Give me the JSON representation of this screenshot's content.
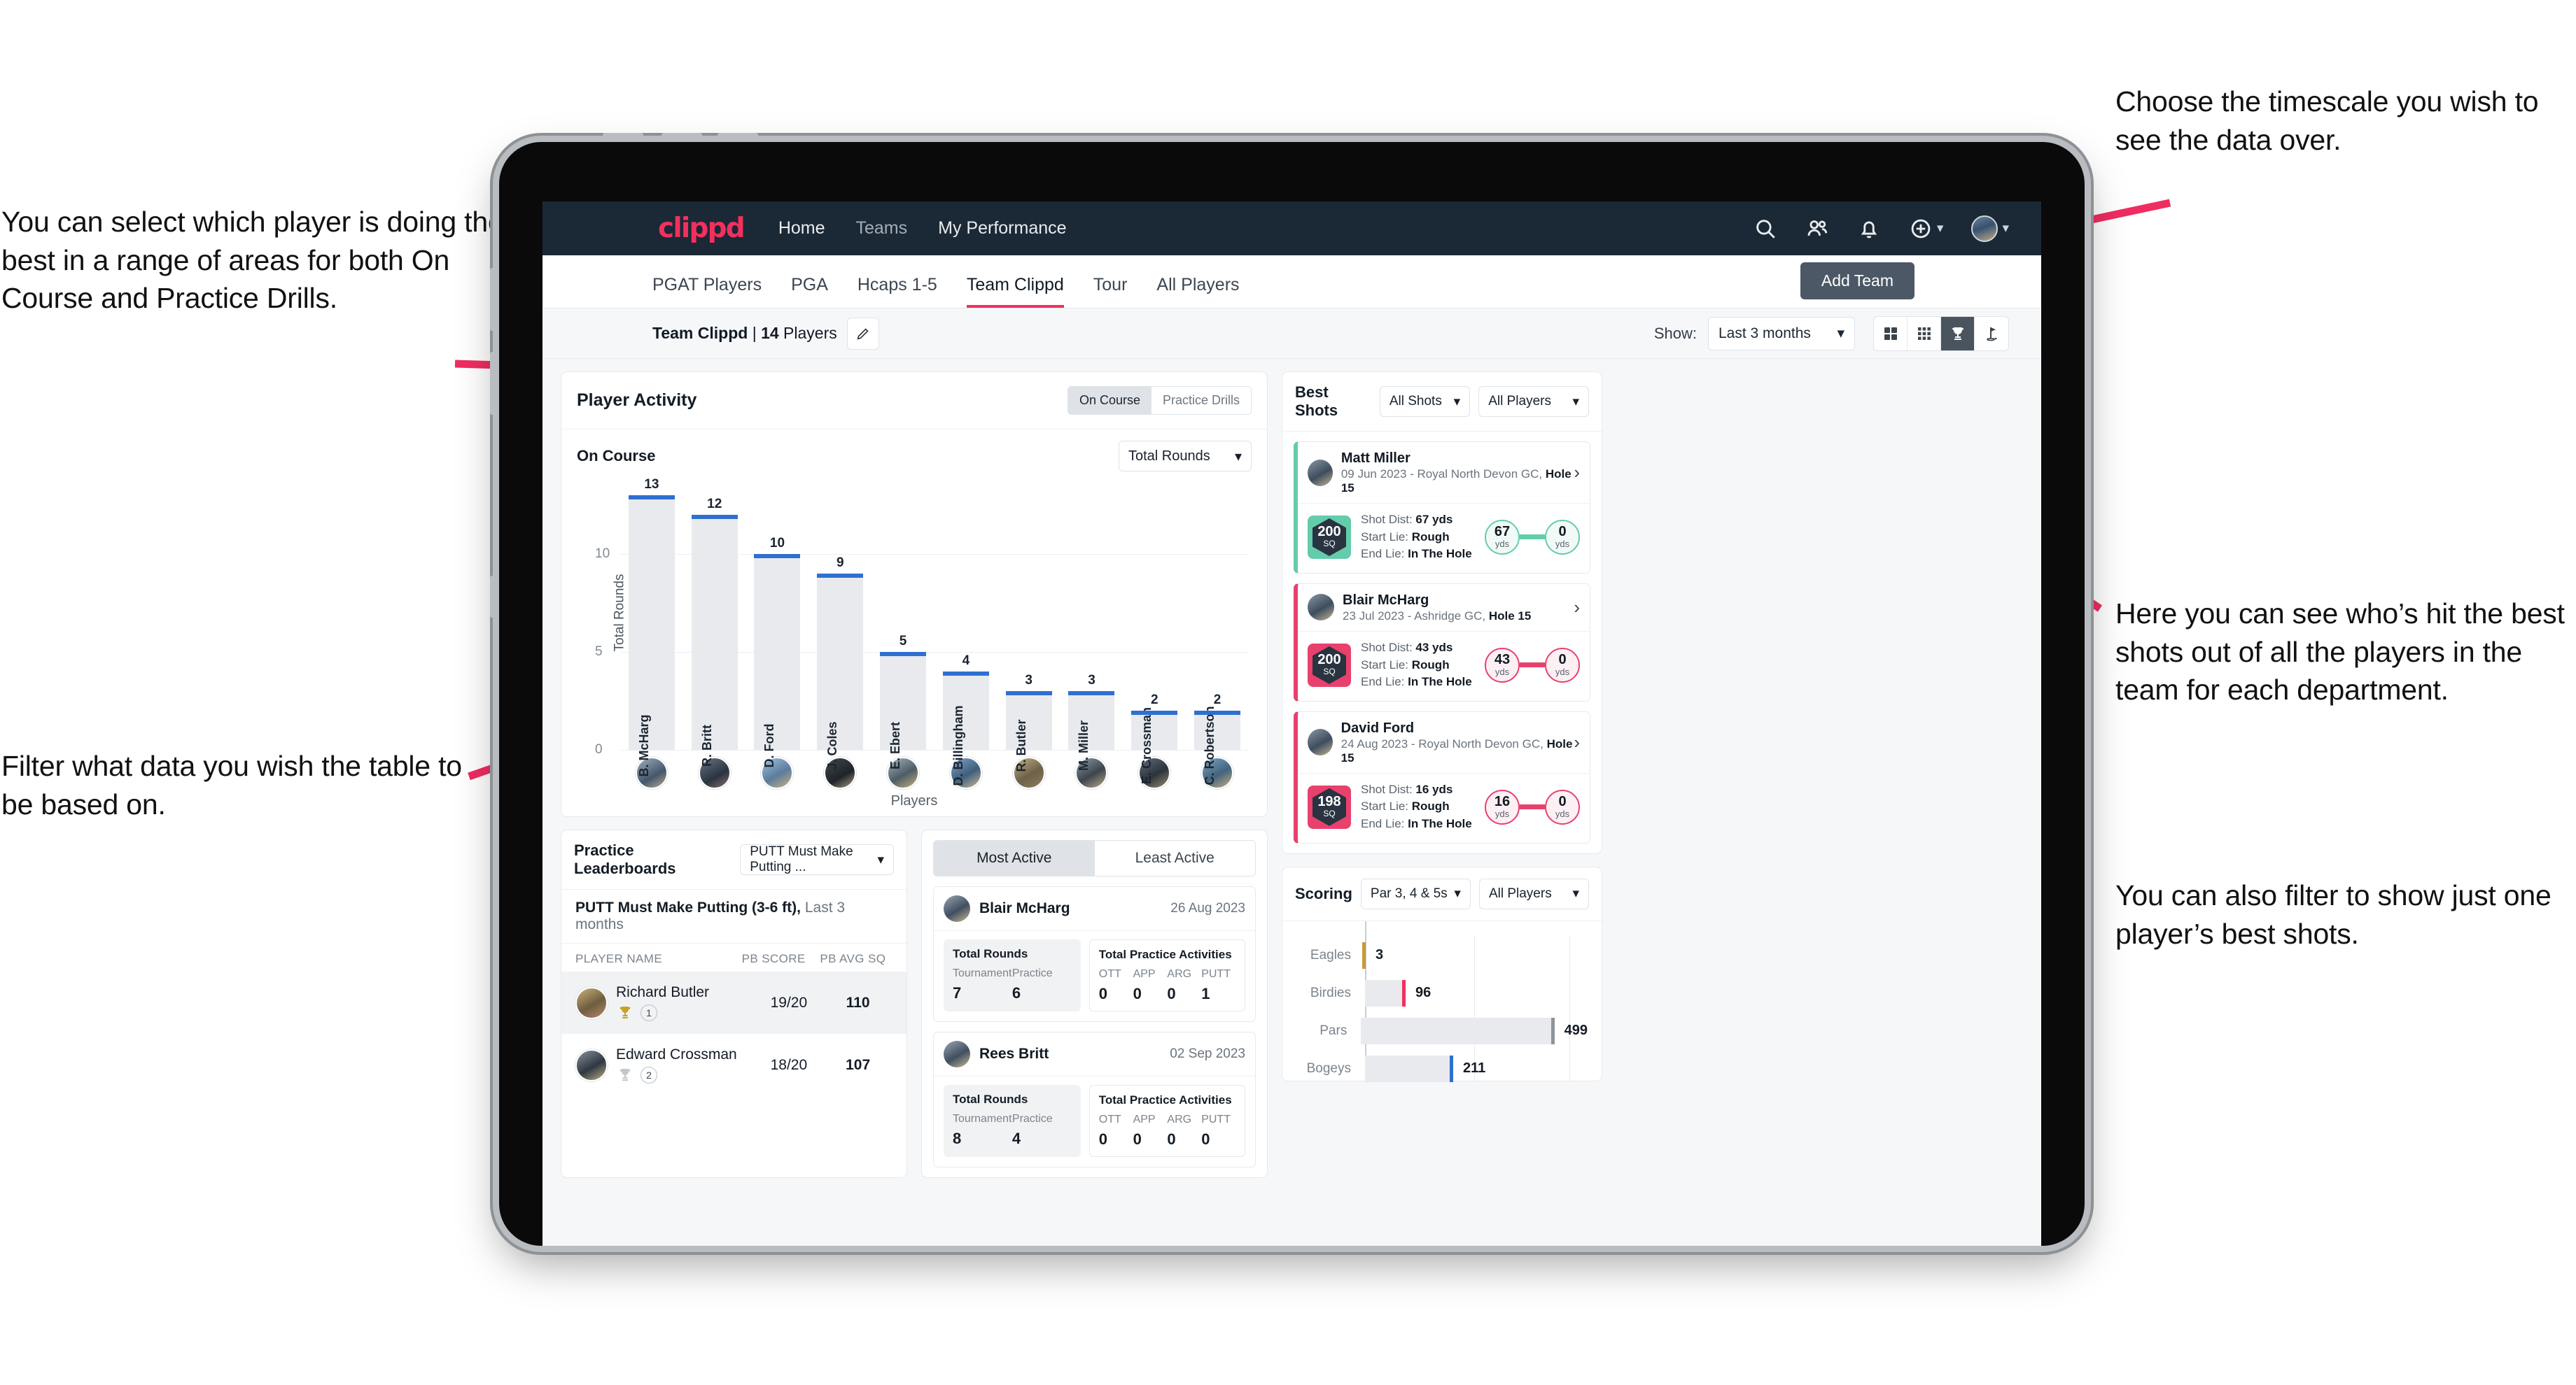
{
  "annotations": {
    "left_top": "You can select which player is doing the best in a range of areas for both On Course and Practice Drills.",
    "left_bottom": "Filter what data you wish the table to be based on.",
    "right_top": "Choose the timescale you wish to see the data over.",
    "right_middle": "Here you can see who’s hit the best shots out of all the players in the team for each department.",
    "right_bottom": "You can also filter to show just one player’s best shots."
  },
  "brand": {
    "logo": "clippd",
    "accent": "#f2305e",
    "navbg": "#1b2836"
  },
  "topnav": {
    "links": [
      {
        "label": "Home"
      },
      {
        "label": "Teams"
      },
      {
        "label": "My Performance"
      }
    ],
    "icons": [
      "search-icon",
      "people-icon",
      "bell-icon",
      "plus-circle-icon",
      "avatar"
    ]
  },
  "tabbar": {
    "tabs": [
      {
        "label": "PGAT Players",
        "active": false
      },
      {
        "label": "PGA",
        "active": false
      },
      {
        "label": "Hcaps 1-5",
        "active": false
      },
      {
        "label": "Team Clippd",
        "active": true
      },
      {
        "label": "Tour",
        "active": false
      },
      {
        "label": "All Players",
        "active": false
      }
    ],
    "add_team_label": "Add Team"
  },
  "subbar": {
    "team_name": "Team Clippd",
    "separator": " | ",
    "player_count": "14",
    "players_word": " Players",
    "show_label": "Show:",
    "timescale_value": "Last 3 months",
    "view_icons": [
      "grid-large-icon",
      "grid-small-icon",
      "trophy-icon",
      "flag-icon"
    ],
    "active_view": "trophy-icon"
  },
  "player_activity": {
    "title": "Player Activity",
    "segmented": [
      {
        "label": "On Course",
        "active": true
      },
      {
        "label": "Practice Drills",
        "active": false
      }
    ],
    "section_label": "On Course",
    "metric_value": "Total Rounds"
  },
  "chart_data": {
    "type": "bar",
    "title": "Player Activity – On Course",
    "xlabel": "Players",
    "ylabel": "Total Rounds",
    "ylim": [
      0,
      14
    ],
    "yticks": [
      "0",
      "5",
      "10"
    ],
    "grid": true,
    "categories": [
      "B. McHarg",
      "R. Britt",
      "D. Ford",
      "J. Coles",
      "E. Ebert",
      "D. Billingham",
      "R. Butler",
      "M. Miller",
      "E. Crossman",
      "C. Robertson"
    ],
    "values": [
      13,
      12,
      10,
      9,
      5,
      4,
      3,
      3,
      2,
      2
    ]
  },
  "best_shots": {
    "title": "Best Shots",
    "filter_shots": "All Shots",
    "filter_players": "All Players",
    "cards": [
      {
        "name": "Matt Miller",
        "meta_date": "09 Jun 2023 - Royal North Devon GC, ",
        "meta_hole": "Hole 15",
        "badge_value": "200",
        "badge_unit": "SQ",
        "shot_dist_label": "Shot Dist: ",
        "shot_dist_value": "67 yds",
        "start_lie_label": "Start Lie: ",
        "start_lie_value": "Rough",
        "end_lie_label": "End Lie: ",
        "end_lie_value": "In The Hole",
        "from_value": "67",
        "from_unit": "yds",
        "to_value": "0",
        "to_unit": "yds",
        "color": "teal"
      },
      {
        "name": "Blair McHarg",
        "meta_date": "23 Jul 2023 - Ashridge GC, ",
        "meta_hole": "Hole 15",
        "badge_value": "200",
        "badge_unit": "SQ",
        "shot_dist_label": "Shot Dist: ",
        "shot_dist_value": "43 yds",
        "start_lie_label": "Start Lie: ",
        "start_lie_value": "Rough",
        "end_lie_label": "End Lie: ",
        "end_lie_value": "In The Hole",
        "from_value": "43",
        "from_unit": "yds",
        "to_value": "0",
        "to_unit": "yds",
        "color": "pink"
      },
      {
        "name": "David Ford",
        "meta_date": "24 Aug 2023 - Royal North Devon GC, ",
        "meta_hole": "Hole 15",
        "badge_value": "198",
        "badge_unit": "SQ",
        "shot_dist_label": "Shot Dist: ",
        "shot_dist_value": "16 yds",
        "start_lie_label": "Start Lie: ",
        "start_lie_value": "Rough",
        "end_lie_label": "End Lie: ",
        "end_lie_value": "In The Hole",
        "from_value": "16",
        "from_unit": "yds",
        "to_value": "0",
        "to_unit": "yds",
        "color": "pink"
      }
    ]
  },
  "practice_leaderboards": {
    "title": "Practice Leaderboards",
    "drill_select": "PUTT Must Make Putting ...",
    "subtitle_bold": "PUTT Must Make Putting (3-6 ft),",
    "subtitle_rest": " Last 3 months",
    "columns": [
      "PLAYER NAME",
      "PB SCORE",
      "PB AVG SQ"
    ],
    "rows": [
      {
        "name": "Richard Butler",
        "rank": "1",
        "trophy": "gold",
        "pb_score": "19/20",
        "pb_avg_sq": "110"
      },
      {
        "name": "Edward Crossman",
        "rank": "2",
        "trophy": "silver",
        "pb_score": "18/20",
        "pb_avg_sq": "107"
      }
    ]
  },
  "activity_panel": {
    "tabs": [
      {
        "label": "Most Active",
        "active": true
      },
      {
        "label": "Least Active",
        "active": false
      }
    ],
    "cards": [
      {
        "name": "Blair McHarg",
        "date": "26 Aug 2023",
        "rounds_title": "Total Rounds",
        "rounds": [
          {
            "label": "Tournament",
            "value": "7"
          },
          {
            "label": "Practice",
            "value": "6"
          }
        ],
        "practice_title": "Total Practice Activities",
        "practice": [
          {
            "label": "OTT",
            "value": "0"
          },
          {
            "label": "APP",
            "value": "0"
          },
          {
            "label": "ARG",
            "value": "0"
          },
          {
            "label": "PUTT",
            "value": "1"
          }
        ]
      },
      {
        "name": "Rees Britt",
        "date": "02 Sep 2023",
        "rounds_title": "Total Rounds",
        "rounds": [
          {
            "label": "Tournament",
            "value": "8"
          },
          {
            "label": "Practice",
            "value": "4"
          }
        ],
        "practice_title": "Total Practice Activities",
        "practice": [
          {
            "label": "OTT",
            "value": "0"
          },
          {
            "label": "APP",
            "value": "0"
          },
          {
            "label": "ARG",
            "value": "0"
          },
          {
            "label": "PUTT",
            "value": "0"
          }
        ]
      }
    ]
  },
  "scoring": {
    "title": "Scoring",
    "filter_par": "Par 3, 4 & 5s",
    "filter_players": "All Players",
    "chart_data": {
      "type": "bar",
      "orientation": "horizontal",
      "title": "Scoring",
      "categories": [
        "Eagles",
        "Birdies",
        "Pars",
        "Bogeys"
      ],
      "values": [
        3,
        96,
        499,
        211
      ],
      "colors": [
        "#c79a3b",
        "#f2305e",
        "#8d949c",
        "#2f6fd0"
      ],
      "xlim": [
        0,
        560
      ],
      "grid": true
    }
  }
}
